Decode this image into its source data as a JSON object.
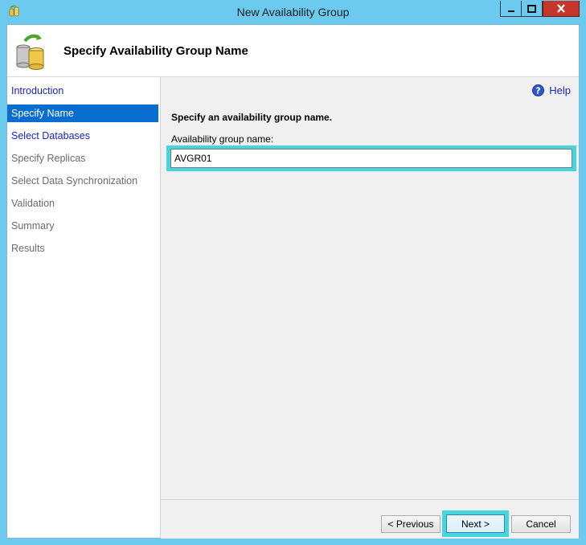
{
  "window": {
    "title": "New Availability Group",
    "title_bar_color": "#6dcaef",
    "close_color": "#c7362a"
  },
  "header": {
    "title": "Specify Availability Group Name",
    "icon": "database-wizard-icon"
  },
  "sidebar": {
    "items": [
      {
        "label": "Introduction",
        "state": "link"
      },
      {
        "label": "Specify Name",
        "state": "active"
      },
      {
        "label": "Select Databases",
        "state": "link"
      },
      {
        "label": "Specify Replicas",
        "state": "disabled"
      },
      {
        "label": "Select Data Synchronization",
        "state": "disabled"
      },
      {
        "label": "Validation",
        "state": "disabled"
      },
      {
        "label": "Summary",
        "state": "disabled"
      },
      {
        "label": "Results",
        "state": "disabled"
      }
    ],
    "active_color": "#0a6ed1",
    "link_color": "#1a23c4"
  },
  "main": {
    "help_label": "Help",
    "instruction": "Specify an availability group name.",
    "field_label": "Availability group name:",
    "field_value": "AVGR01",
    "highlight_color": "#44d6dc"
  },
  "footer": {
    "previous_label": "< Previous",
    "next_label": "Next >",
    "cancel_label": "Cancel"
  }
}
